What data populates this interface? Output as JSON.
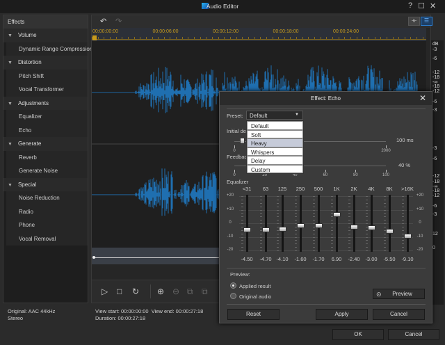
{
  "window": {
    "title": "Audio Editor",
    "help": "?",
    "maximize": "☐",
    "close": "✕"
  },
  "sidebar": {
    "header": "Effects",
    "groups": [
      {
        "label": "Volume",
        "items": [
          "Dynamic Range Compression"
        ]
      },
      {
        "label": "Distortion",
        "items": [
          "Pitch Shift",
          "Vocal Transformer"
        ]
      },
      {
        "label": "Adjustments",
        "items": [
          "Equalizer",
          "Echo"
        ]
      },
      {
        "label": "Generate",
        "items": [
          "Reverb",
          "Generate Noise"
        ]
      },
      {
        "label": "Special",
        "items": [
          "Noise Reduction",
          "Radio",
          "Phone",
          "Vocal Removal"
        ]
      }
    ]
  },
  "timeline": {
    "timecodes": [
      "00:00:00:00",
      "00:00:06:00",
      "00:00:12:00",
      "00:00:18:00",
      "00:00:24:00"
    ]
  },
  "db_scale": {
    "unit": "dB",
    "labels": [
      "-3",
      "-6",
      "-12",
      "-18",
      "-∞",
      "-18",
      "-12",
      "-6",
      "-3",
      "-3",
      "-6",
      "-12",
      "-18",
      "-∞",
      "-18",
      "-12",
      "-6",
      "-3",
      "12",
      "0"
    ]
  },
  "status": {
    "original": "Original: AAC 44kHz",
    "channels": "Stereo",
    "view_start": "View start: 00:00:00:00",
    "view_end": "View end: 00:00:27:18",
    "duration": "Duration: 00:00:27:18"
  },
  "footer": {
    "ok": "OK",
    "cancel": "Cancel"
  },
  "dialog": {
    "title": "Effect: Echo",
    "preset_label": "Preset:",
    "preset_value": "Default",
    "preset_options": [
      "Default",
      "Soft",
      "Heavy",
      "Whispers",
      "Delay",
      "Custom"
    ],
    "highlighted_option": "Heavy",
    "initial_delay": {
      "label": "Initial delay",
      "value": 100,
      "value_text": "100 ms",
      "min": 0,
      "max": 2000,
      "ticks": [
        "0",
        "2000"
      ]
    },
    "feedback": {
      "label": "Feedback",
      "value": 40,
      "value_text": "40 %",
      "min": 0,
      "max": 100,
      "ticks": [
        "0",
        "20",
        "40",
        "60",
        "80",
        "100"
      ]
    },
    "equalizer": {
      "label": "Equalizer",
      "scale": [
        "+20",
        "+10",
        "0",
        "-10",
        "-20"
      ],
      "bands": [
        {
          "freq": "<31",
          "value": -4.5,
          "text": "-4.50"
        },
        {
          "freq": "63",
          "value": -4.7,
          "text": "-4.70"
        },
        {
          "freq": "125",
          "value": -4.1,
          "text": "-4.10"
        },
        {
          "freq": "250",
          "value": -1.6,
          "text": "-1.60"
        },
        {
          "freq": "500",
          "value": -1.7,
          "text": "-1.70"
        },
        {
          "freq": "1K",
          "value": 6.9,
          "text": "6.90"
        },
        {
          "freq": "2K",
          "value": -2.4,
          "text": "-2.40"
        },
        {
          "freq": "4K",
          "value": -3.0,
          "text": "-3.00"
        },
        {
          "freq": "8K",
          "value": -5.5,
          "text": "-5.50"
        },
        {
          "freq": ">16K",
          "value": -9.1,
          "text": "-9.10"
        }
      ]
    },
    "preview": {
      "label": "Preview:",
      "applied": "Applied result",
      "original": "Original audio",
      "selected": "applied",
      "button": "Preview"
    },
    "buttons": {
      "reset": "Reset",
      "apply": "Apply",
      "cancel": "Cancel"
    }
  },
  "colors": {
    "waveform": "#1f6fb0",
    "timecode": "#c79a1c",
    "accent": "#2a7fd4"
  }
}
